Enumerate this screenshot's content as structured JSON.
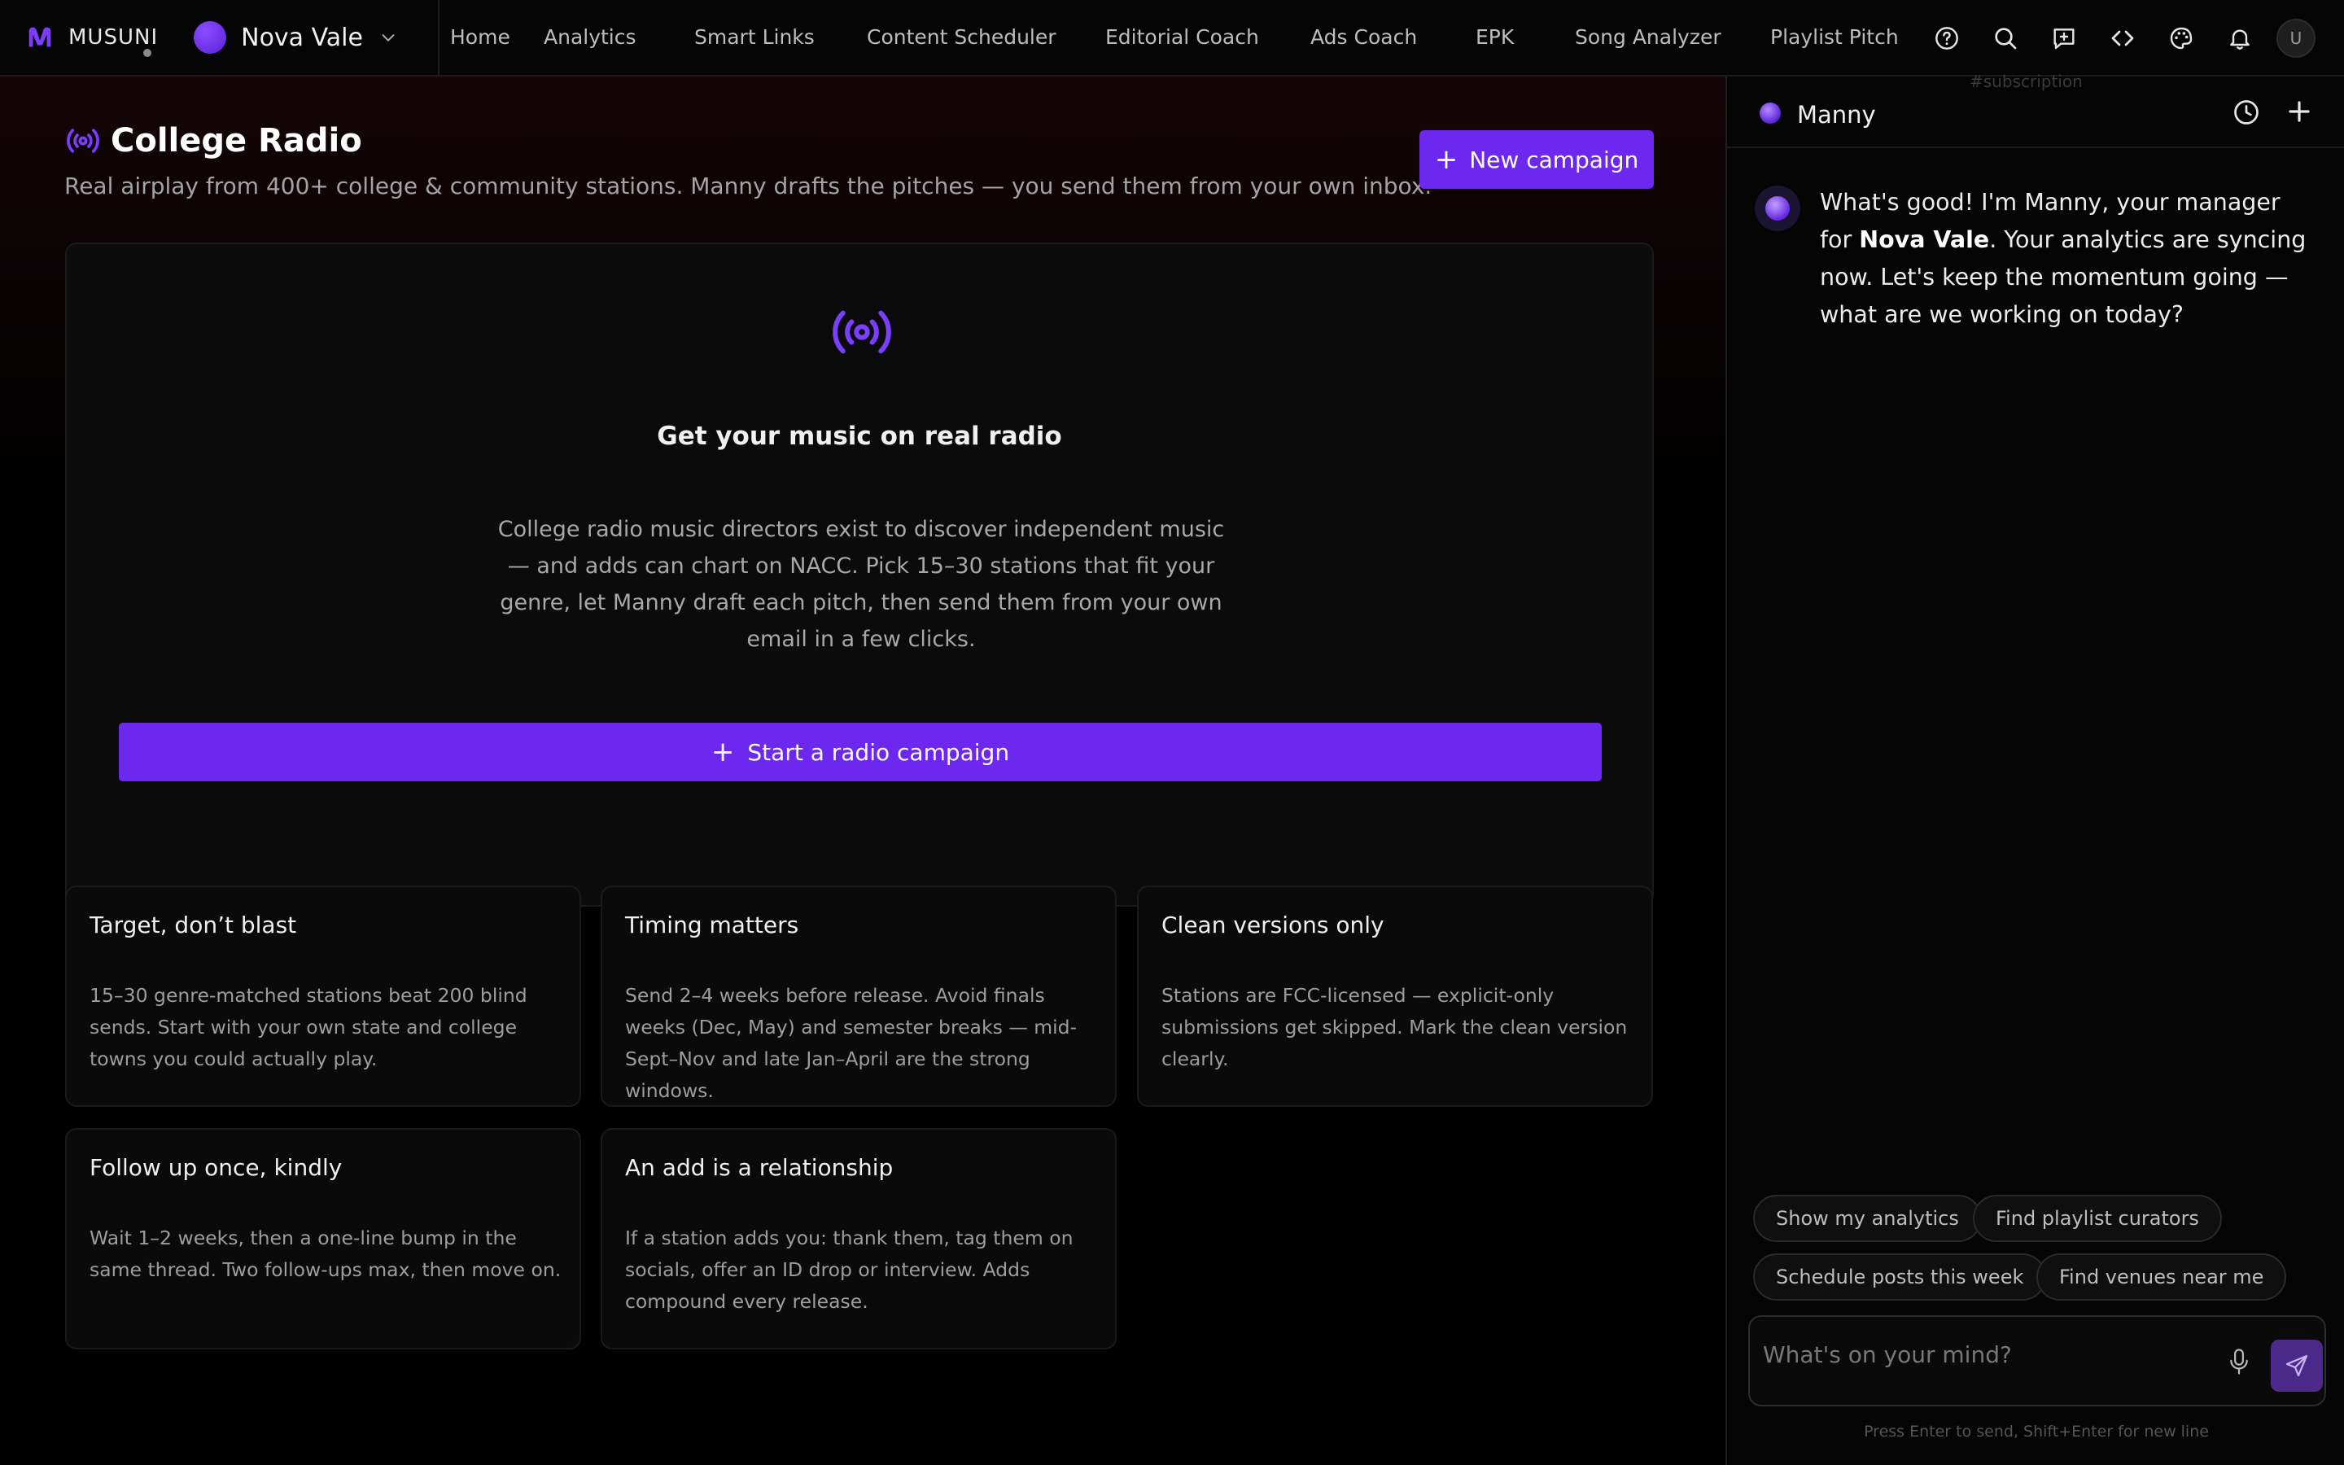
{
  "brand": {
    "name": "MUSUNI"
  },
  "artist": {
    "name": "Nova Vale"
  },
  "nav": {
    "links": [
      "Home",
      "Analytics",
      "Smart Links",
      "Content Scheduler",
      "Editorial Coach",
      "Ads Coach",
      "EPK",
      "Song Analyzer",
      "Playlist Pitch"
    ],
    "icons": [
      "help-icon",
      "search-icon",
      "feedback-icon",
      "code-icon",
      "palette-icon",
      "bell-icon"
    ],
    "user_initial": "U"
  },
  "page": {
    "title": "College Radio",
    "subtitle": "Real airplay from 400+ college & community stations. Manny drafts the pitches — you send them from your own inbox.",
    "new_campaign_label": "New campaign"
  },
  "hero": {
    "title": "Get your music on real radio",
    "description": "College radio music directors exist to discover independent music — and adds can chart on NACC. Pick 15–30 stations that fit your genre, let Manny draft each pitch, then send them from your own email in a few clicks.",
    "button_label": "Start a radio campaign"
  },
  "tips": [
    {
      "title": "Target, don’t blast",
      "body": "15–30 genre-matched stations beat 200 blind sends. Start with your own state and college towns you could actually play."
    },
    {
      "title": "Timing matters",
      "body": "Send 2–4 weeks before release. Avoid finals weeks (Dec, May) and semester breaks — mid-Sept–Nov and late Jan–April are the strong windows."
    },
    {
      "title": "Clean versions only",
      "body": "Stations are FCC-licensed — explicit-only submissions get skipped. Mark the clean version clearly."
    },
    {
      "title": "Follow up once, kindly",
      "body": "Wait 1–2 weeks, then a one-line bump in the same thread. Two follow-ups max, then move on."
    },
    {
      "title": "An add is a relationship",
      "body": "If a station adds you: thank them, tag them on socials, offer an ID drop or interview. Adds compound every release."
    }
  ],
  "assistant": {
    "name": "Manny",
    "ghost_text": "#subscription",
    "message_parts": [
      "What's good! I'm Manny, your manager for ",
      "Nova Vale",
      ". Your analytics are syncing now. Let's keep the momentum going — what are we working on today?"
    ],
    "chips": [
      "Show my analytics",
      "Find playlist curators",
      "Schedule posts this week",
      "Find venues near me"
    ],
    "input_placeholder": "What's on your mind?",
    "hint": "Press Enter to send, Shift+Enter for new line"
  },
  "colors": {
    "accent": "#6d28f0",
    "background": "#000000",
    "panel": "#050505"
  }
}
